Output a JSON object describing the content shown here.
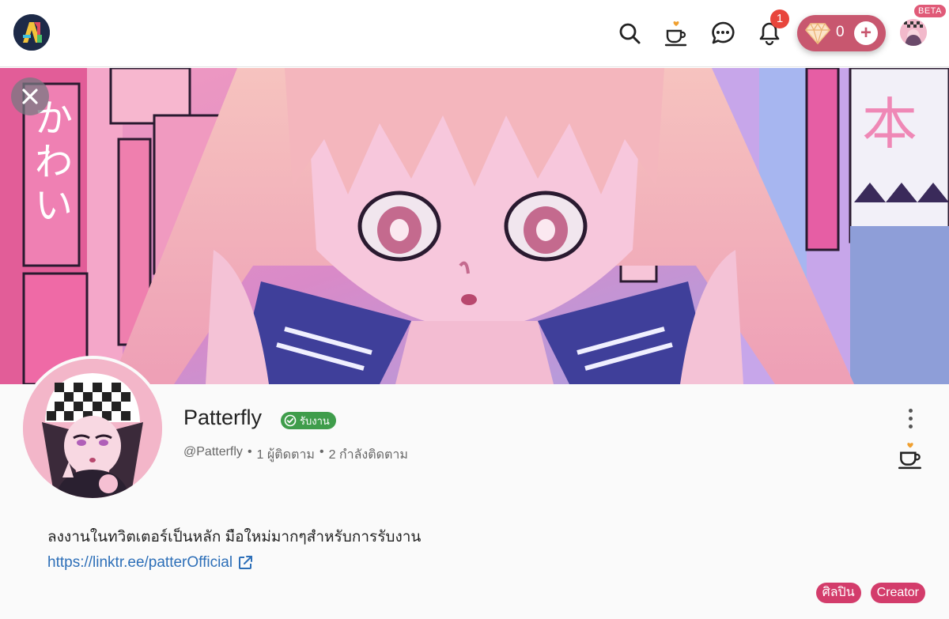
{
  "topbar": {
    "logo_icon": "app-logo",
    "icons": [
      "search-icon",
      "coffee-icon",
      "chat-icon",
      "bell-icon"
    ],
    "notification_count": "1",
    "gem_count": "0",
    "gem_plus": "+",
    "beta_label": "BETA"
  },
  "profile": {
    "display_name": "Patterfly",
    "status_badge": "รับงาน",
    "handle": "@Patterfly",
    "separator": "•",
    "followers": "1 ผู้ติดตาม",
    "following": "2 กำลังติดตาม",
    "bio": "ลงงานในทวิตเตอร์เป็นหลัก มือใหม่มากๆสำหรับการรับงาน",
    "link": "https://linktr.ee/patterOfficial",
    "tags": [
      "ศิลปิน",
      "Creator"
    ]
  },
  "colors": {
    "accent": "#d33c6b",
    "gem_pill": "#c8576f",
    "notif_badge": "#e8453c",
    "status_green": "#3f9d4b",
    "link": "#2d6fb8"
  }
}
